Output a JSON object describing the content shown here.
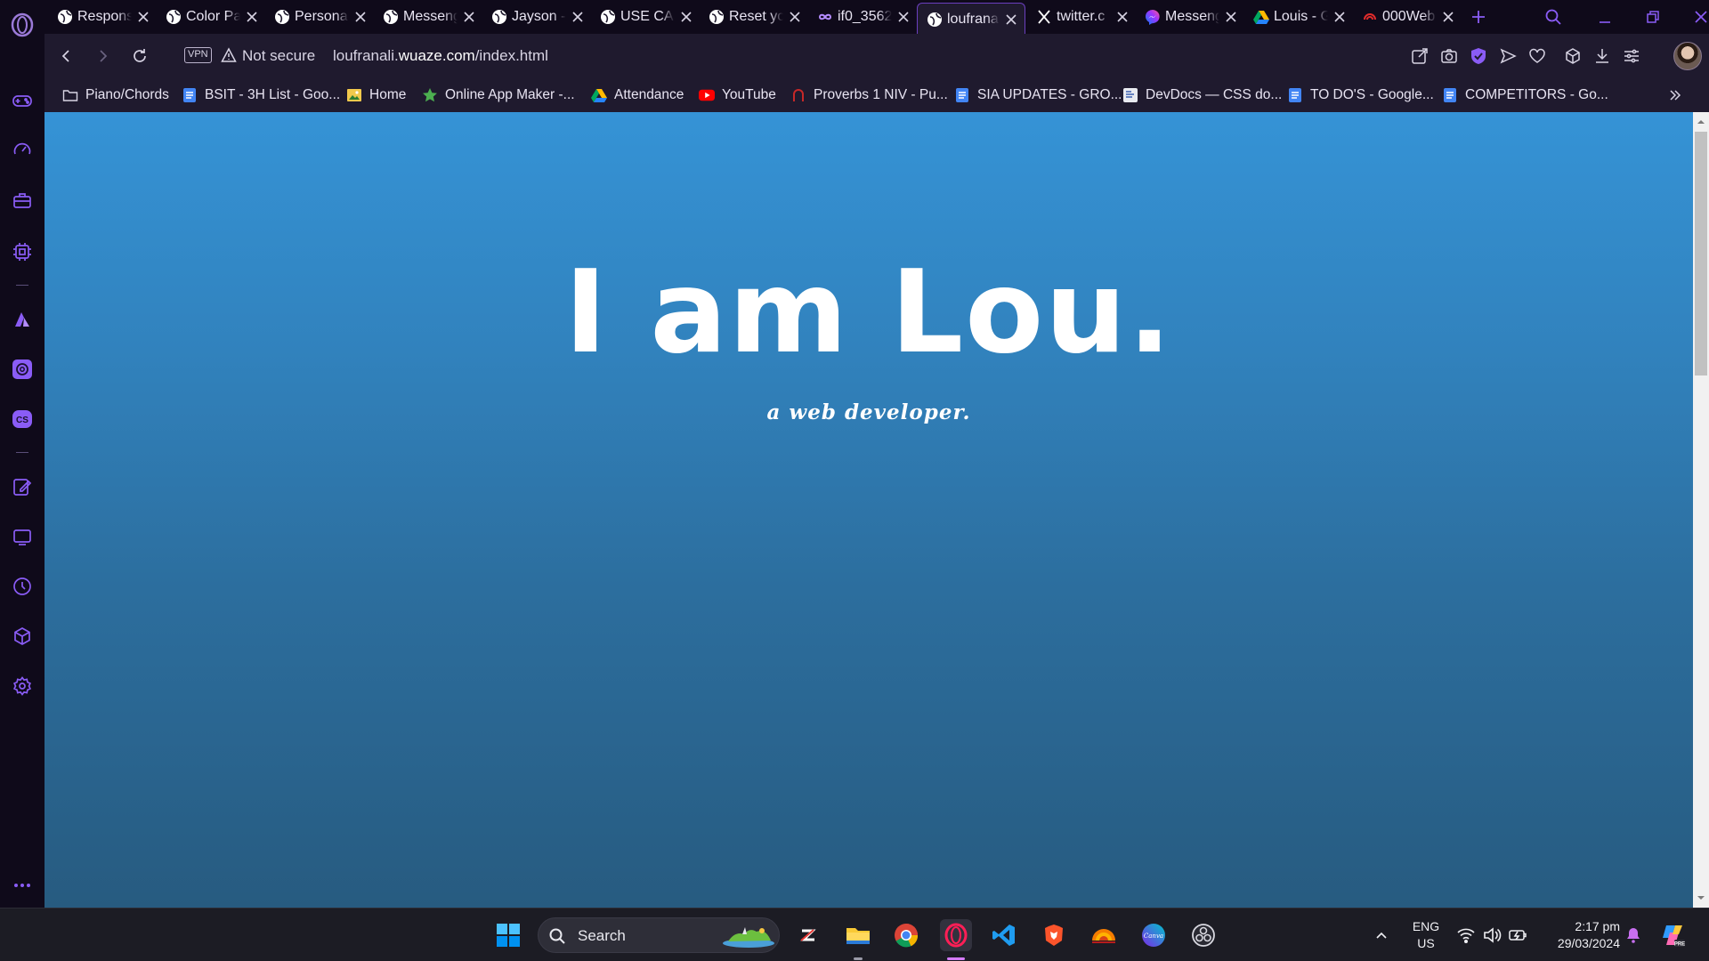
{
  "browser": {
    "tabs": [
      {
        "title": "Respons",
        "icon": "globe-icon",
        "active": false
      },
      {
        "title": "Color Pa",
        "icon": "globe-icon",
        "active": false
      },
      {
        "title": "Personal",
        "icon": "globe-icon",
        "active": false
      },
      {
        "title": "Messeng",
        "icon": "globe-icon",
        "active": false
      },
      {
        "title": "Jayson -",
        "icon": "globe-icon",
        "active": false
      },
      {
        "title": "USE CAS",
        "icon": "globe-icon",
        "active": false
      },
      {
        "title": "Reset yo",
        "icon": "globe-icon",
        "active": false
      },
      {
        "title": "if0_3562",
        "icon": "infinity-icon",
        "active": false
      },
      {
        "title": "loufrana",
        "icon": "globe-icon",
        "active": true
      },
      {
        "title": "twitter.c",
        "icon": "x-logo-icon",
        "active": false
      },
      {
        "title": "Messeng",
        "icon": "messenger-icon",
        "active": false
      },
      {
        "title": "Louis - G",
        "icon": "google-drive-icon",
        "active": false
      },
      {
        "title": "000Web",
        "icon": "000webhost-icon",
        "active": false
      }
    ],
    "address": {
      "vpn_label": "VPN",
      "security_label": "Not secure",
      "url_prefix": "loufranali.",
      "url_domain": "wuaze.com",
      "url_path": "/index.html"
    },
    "bookmarks": [
      {
        "label": "Piano/Chords",
        "icon": "folder-icon"
      },
      {
        "label": "BSIT - 3H List - Goo...",
        "icon": "google-docs-icon"
      },
      {
        "label": "Home",
        "icon": "home-image-icon"
      },
      {
        "label": "Online App Maker -...",
        "icon": "star-icon"
      },
      {
        "label": "Attendance",
        "icon": "google-drive-icon"
      },
      {
        "label": "YouTube",
        "icon": "youtube-icon"
      },
      {
        "label": "Proverbs 1 NIV - Pu...",
        "icon": "bible-gateway-icon"
      },
      {
        "label": "SIA UPDATES - GRO...",
        "icon": "google-docs-icon"
      },
      {
        "label": "DevDocs — CSS do...",
        "icon": "devdocs-icon"
      },
      {
        "label": "TO DO'S - Google...",
        "icon": "google-docs-icon"
      },
      {
        "label": "COMPETITORS - Go...",
        "icon": "google-docs-icon"
      }
    ]
  },
  "page": {
    "hero_title": "I am Lou.",
    "hero_subtitle": "a web developer."
  },
  "taskbar": {
    "search_label": "Search",
    "language": "ENG",
    "region": "US",
    "time": "2:17 pm",
    "date": "29/03/2024"
  },
  "colors": {
    "accent": "#8b5cf6",
    "page_gradient_top": "#3593d6",
    "page_gradient_bottom": "#275b80",
    "browser_chrome": "#1f1a2e"
  }
}
